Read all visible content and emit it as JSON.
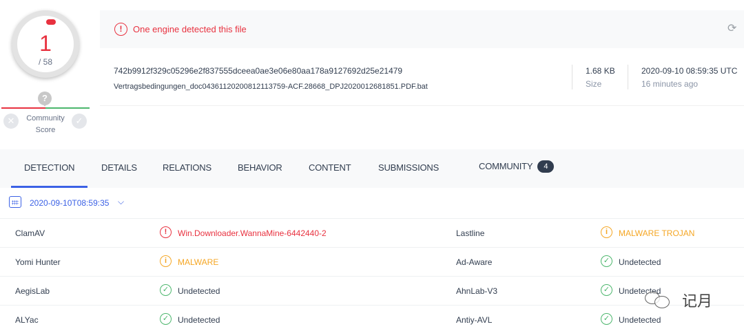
{
  "score": {
    "detections": "1",
    "total": "/ 58",
    "help": "?",
    "community_label_1": "Community",
    "community_label_2": "Score"
  },
  "alert": {
    "icon": "!",
    "text": "One engine detected this file"
  },
  "file": {
    "hash": "742b9912f329c05296e2f837555dceea0ae3e06e80aa178a9127692d25e21479",
    "name": "Vertragsbedingungen_doc04361120200812113759-ACF.28668_DPJ2020012681851.PDF.bat",
    "size": "1.68 KB",
    "size_label": "Size",
    "date": "2020-09-10 08:59:35 UTC",
    "date_ago": "16 minutes ago"
  },
  "tabs": [
    {
      "label": "DETECTION"
    },
    {
      "label": "DETAILS"
    },
    {
      "label": "RELATIONS"
    },
    {
      "label": "BEHAVIOR"
    },
    {
      "label": "CONTENT"
    },
    {
      "label": "SUBMISSIONS"
    },
    {
      "label": "COMMUNITY",
      "count": "4"
    }
  ],
  "analysis_date": "2020-09-10T08:59:35",
  "results": [
    [
      {
        "engine": "ClamAV",
        "status": "malicious",
        "result": "Win.Downloader.WannaMine-6442440-2"
      },
      {
        "engine": "Lastline",
        "status": "suspicious",
        "result": "MALWARE TROJAN"
      }
    ],
    [
      {
        "engine": "Yomi Hunter",
        "status": "suspicious",
        "result": "MALWARE"
      },
      {
        "engine": "Ad-Aware",
        "status": "undetected",
        "result": "Undetected"
      }
    ],
    [
      {
        "engine": "AegisLab",
        "status": "undetected",
        "result": "Undetected"
      },
      {
        "engine": "AhnLab-V3",
        "status": "undetected",
        "result": "Undetected"
      }
    ],
    [
      {
        "engine": "ALYac",
        "status": "undetected",
        "result": "Undetected"
      },
      {
        "engine": "Antiy-AVL",
        "status": "undetected",
        "result": "Undetected"
      }
    ]
  ],
  "icons": {
    "malicious": "!",
    "suspicious": "i",
    "undetected": "✓"
  },
  "watermark": "记月",
  "colors": {
    "malicious": "#e8313f",
    "suspicious": "#f5a623",
    "undetected": "#4bb66c",
    "accent": "#3b61e5"
  }
}
